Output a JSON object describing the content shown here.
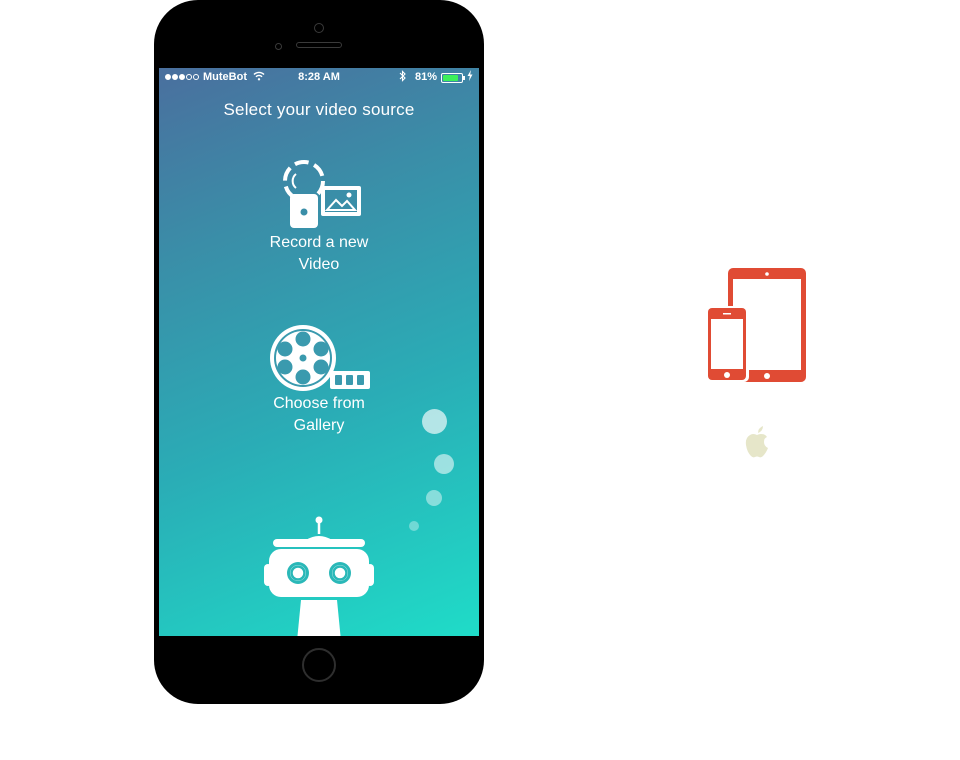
{
  "status_bar": {
    "carrier": "MuteBot",
    "time": "8:28 AM",
    "battery_percent": "81%",
    "battery_level": 0.81,
    "signal_bars": 3,
    "signal_total": 5
  },
  "screen": {
    "title": "Select your video source",
    "options": [
      {
        "label_line1": "Record a new",
        "label_line2": "Video",
        "icon": "record-video-icon"
      },
      {
        "label_line1": "Choose from",
        "label_line2": "Gallery",
        "icon": "film-reel-icon"
      }
    ]
  },
  "colors": {
    "gradient_top": "#4a6f9e",
    "gradient_bottom": "#1fdcc8",
    "device_icon": "#e04b34",
    "apple_logo": "#e6e6c9",
    "battery_green": "#3cf05a"
  },
  "side_icons": [
    "iphone-ipad-icon",
    "apple-logo-icon"
  ]
}
